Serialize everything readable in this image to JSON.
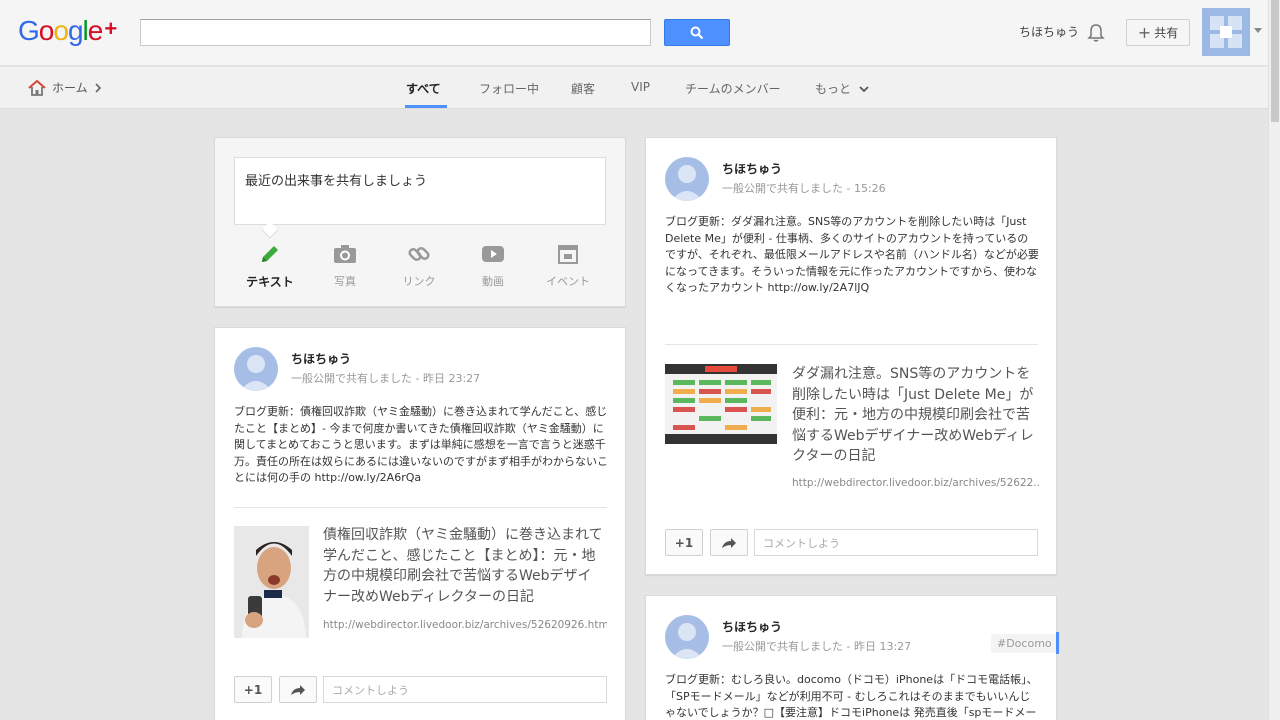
{
  "header": {
    "logo_letters": [
      "G",
      "o",
      "o",
      "g",
      "l",
      "e"
    ],
    "logo_plus": "+",
    "search_placeholder": "",
    "username": "ちほちゅう",
    "share_label": "共有",
    "share_plus": "+"
  },
  "subnav": {
    "home_label": "ホーム",
    "tabs": [
      "すべて",
      "フォロー中",
      "顧客",
      "VIP",
      "チームのメンバー",
      "もっと"
    ]
  },
  "share_card": {
    "placeholder": "最近の出来事を共有しましょう",
    "options": [
      "テキスト",
      "写真",
      "リンク",
      "動画",
      "イベント"
    ]
  },
  "posts": [
    {
      "author": "ちほちゅう",
      "meta": "一般公開で共有しました  -  昨日 23:27",
      "body": "ブログ更新：債権回収詐欺（ヤミ金騒動）に巻き込まれて学んだこと、感じたこと【まとめ】- 今まで何度か書いてきた債権回収詐欺（ヤミ金騒動）に関してまとめておこうと思います。まずは単純に感想を一言で言うと迷惑千万。責任の所在は奴らにあるには違いないのですがまず相手がわからないことには何の手の http://ow.ly/2A6rQa",
      "link_title": "債権回収詐欺（ヤミ金騒動）に巻き込まれて学んだこと、感じたこと【まとめ】：元・地方の中規模印刷会社で苦悩するWebデザイナー改めWebディレクターの日記",
      "link_url": "http://webdirector.livedoor.biz/archives/52620926.html",
      "plus_one": "+1",
      "comment_placeholder": "コメントしよう"
    },
    {
      "author": "ちほちゅう",
      "meta": "一般公開で共有しました  -  15:26",
      "body": "ブログ更新：ダダ漏れ注意。SNS等のアカウントを削除したい時は「Just Delete Me」が便利 - 仕事柄、多くのサイトのアカウントを持っているのですが、それぞれ、最低限メールアドレスや名前（ハンドル名）などが必要になってきます。そういった情報を元に作ったアカウントですから、使わなくなったアカウント http://ow.ly/2A7lJQ",
      "link_title": "ダダ漏れ注意。SNS等のアカウントを削除したい時は「Just Delete Me」が便利：元・地方の中規模印刷会社で苦悩するWebデザイナー改めWebディレクターの日記",
      "link_url": "http://webdirector.livedoor.biz/archives/52622...",
      "plus_one": "+1",
      "comment_placeholder": "コメントしよう"
    },
    {
      "author": "ちほちゅう",
      "meta": "一般公開で共有しました  -  昨日 13:27",
      "hashtag": "#Docomo",
      "body": "ブログ更新：むしろ良い。docomo（ドコモ）iPhoneは「ドコモ電話帳」、「SPモードメール」などが利用不可 - むしろこれはそのままでもいいんじゃないでしょうか？□【要注意】ドコモiPhoneは 発売直後「spモードメール」「ドコモ"
    }
  ],
  "colors": {
    "accent": "#4d90fe",
    "background": "#e5e5e5",
    "pencil": "#3cab3c"
  }
}
